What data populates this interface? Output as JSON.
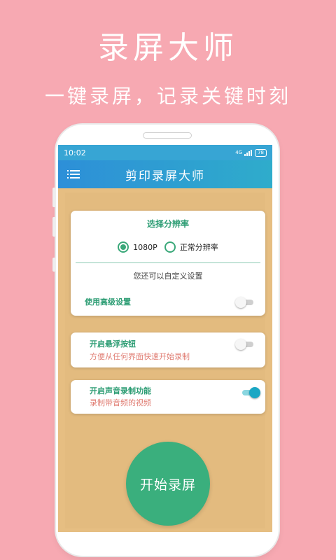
{
  "promo": {
    "title": "录屏大师",
    "subtitle": "一键录屏，记录关键时刻"
  },
  "status_bar": {
    "time": "10:02",
    "network": "4G",
    "battery": "78"
  },
  "app_bar": {
    "title": "剪印录屏大师",
    "menu_icon": "menu-icon"
  },
  "resolution_card": {
    "title": "选择分辨率",
    "options": [
      {
        "label": "1080P",
        "selected": true
      },
      {
        "label": "正常分辨率",
        "selected": false
      }
    ],
    "note": "您还可以自定义设置",
    "advanced_label": "使用高级设置",
    "advanced_enabled": false
  },
  "float_card": {
    "label": "开启悬浮按钮",
    "description": "方便从任何界面快速开始录制",
    "enabled": false
  },
  "audio_card": {
    "label": "开启声音录制功能",
    "description": "录制带音频的视频",
    "enabled": true
  },
  "start_button": {
    "label": "开始录屏"
  },
  "colors": {
    "background": "#f7a9b2",
    "app_bar": "#2d8fd8",
    "accent_green": "#3aaf7d",
    "content_bg": "#e3bb7f",
    "description_red": "#e07d73",
    "toggle_on": "#1aa7c4"
  }
}
